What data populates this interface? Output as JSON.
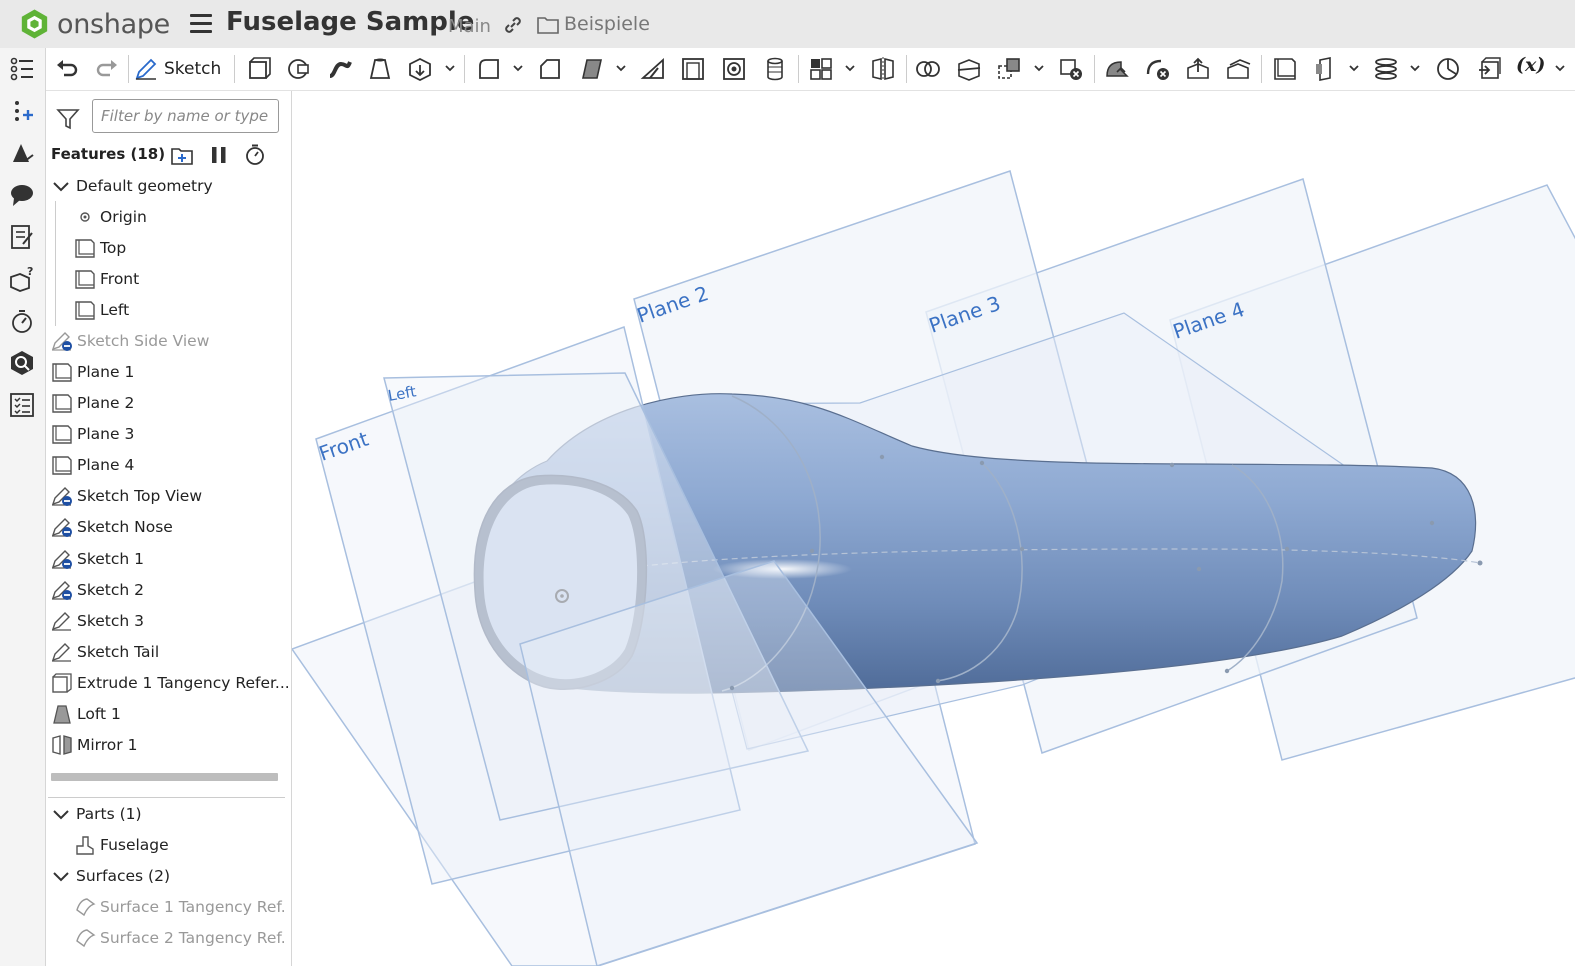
{
  "app": {
    "brand": "onshape",
    "brand_color": "#5fb337",
    "accent": "#3b72c4"
  },
  "header": {
    "title": "Fuselage Sample",
    "branch": "Main",
    "folder": "Beispiele"
  },
  "toolbar": {
    "sketch_label": "Sketch",
    "variable_label": "(x)"
  },
  "filter": {
    "placeholder": "Filter by name or type"
  },
  "features": {
    "header": "Features (18)",
    "default_geometry": {
      "label": "Default geometry",
      "items": [
        {
          "label": "Origin",
          "icon": "origin-icon"
        },
        {
          "label": "Top",
          "icon": "plane-icon"
        },
        {
          "label": "Front",
          "icon": "plane-icon"
        },
        {
          "label": "Left",
          "icon": "plane-icon"
        }
      ]
    },
    "items": [
      {
        "label": "Sketch Side View",
        "icon": "sketch-suppressed-icon",
        "dim": true
      },
      {
        "label": "Plane 1",
        "icon": "plane-icon"
      },
      {
        "label": "Plane 2",
        "icon": "plane-icon"
      },
      {
        "label": "Plane 3",
        "icon": "plane-icon"
      },
      {
        "label": "Plane 4",
        "icon": "plane-icon"
      },
      {
        "label": "Sketch Top View",
        "icon": "sketch-hidden-icon"
      },
      {
        "label": "Sketch Nose",
        "icon": "sketch-hidden-icon"
      },
      {
        "label": "Sketch 1",
        "icon": "sketch-hidden-icon"
      },
      {
        "label": "Sketch 2",
        "icon": "sketch-hidden-icon"
      },
      {
        "label": "Sketch 3",
        "icon": "sketch-icon"
      },
      {
        "label": "Sketch Tail",
        "icon": "sketch-icon"
      },
      {
        "label": "Extrude 1 Tangency Refer...",
        "icon": "extrude-icon"
      },
      {
        "label": "Loft 1",
        "icon": "loft-icon"
      },
      {
        "label": "Mirror 1",
        "icon": "mirror-icon"
      }
    ]
  },
  "parts": {
    "label": "Parts (1)",
    "items": [
      {
        "label": "Fuselage",
        "icon": "part-icon"
      }
    ]
  },
  "surfaces": {
    "label": "Surfaces (2)",
    "items": [
      {
        "label": "Surface 1 Tangency Ref.",
        "icon": "surface-icon"
      },
      {
        "label": "Surface 2 Tangency Ref.",
        "icon": "surface-icon"
      }
    ]
  },
  "viewport": {
    "plane_labels": {
      "front": "Front",
      "left": "Left",
      "plane2": "Plane 2",
      "plane3": "Plane 3",
      "plane4": "Plane 4"
    },
    "colors": {
      "plane_fill": "#eef3fa",
      "plane_stroke": "#9ab4da",
      "body": "#8aa7cf"
    }
  }
}
